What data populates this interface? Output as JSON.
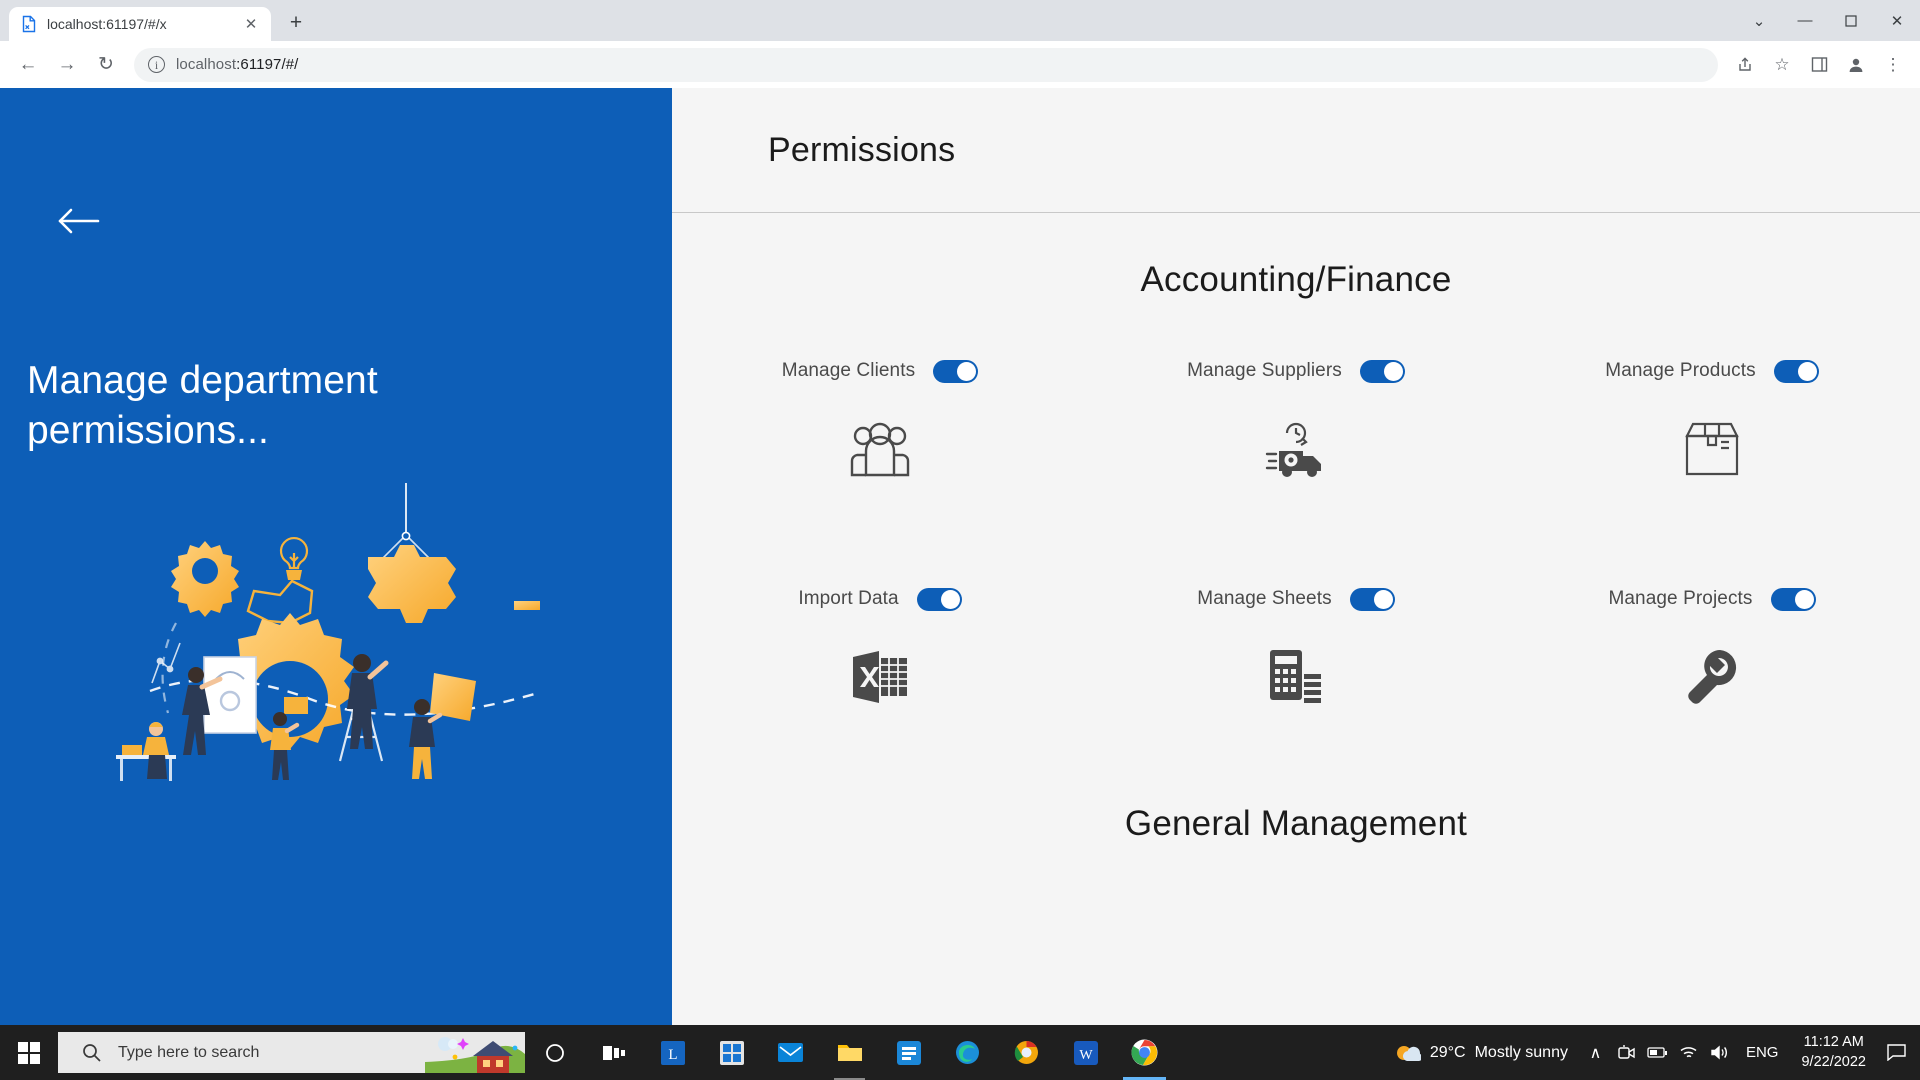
{
  "browser": {
    "tab": {
      "title": "localhost:61197/#/x",
      "favicon": "page-icon",
      "close_label": "✕"
    },
    "newtab_label": "+",
    "window_controls": {
      "minimize": "—",
      "maximize": "❐",
      "close": "✕",
      "chevron": "⌄"
    },
    "nav": {
      "back": "←",
      "forward": "→",
      "reload": "↻"
    },
    "omnibox": {
      "info_glyph": "i",
      "url_dim": "localhost",
      "url_rest": ":61197/#/",
      "full_url": "localhost:61197/#/"
    },
    "toolbar_icons": {
      "share": "share-icon",
      "bookmark": "☆",
      "sidepanel": "sidepanel-icon",
      "profile": "profile-icon",
      "menu": "⋮"
    }
  },
  "left_panel": {
    "back_button": "back-arrow",
    "heading": "Manage department permissions...",
    "illustration": "teamwork-gears-illustration",
    "bg_color": "#0d5eb7",
    "accent_color": "#f9b233"
  },
  "page": {
    "title": "Permissions",
    "sections": [
      {
        "title": "Accounting/Finance",
        "items": [
          {
            "label": "Manage Clients",
            "enabled": true,
            "icon": "people-group-icon"
          },
          {
            "label": "Manage Suppliers",
            "enabled": true,
            "icon": "delivery-truck-icon"
          },
          {
            "label": "Manage Products",
            "enabled": true,
            "icon": "package-box-icon"
          },
          {
            "label": "Import Data",
            "enabled": true,
            "icon": "excel-spreadsheet-icon"
          },
          {
            "label": "Manage Sheets",
            "enabled": true,
            "icon": "calculator-icon"
          },
          {
            "label": "Manage Projects",
            "enabled": true,
            "icon": "wrench-icon"
          }
        ]
      },
      {
        "title": "General Management",
        "items": []
      }
    ]
  },
  "taskbar": {
    "start": "windows-start-icon",
    "search_placeholder": "Type here to search",
    "apps": [
      {
        "name": "cortana-icon"
      },
      {
        "name": "task-view-icon"
      },
      {
        "name": "app-l-icon"
      },
      {
        "name": "microsoft-store-icon"
      },
      {
        "name": "mail-icon"
      },
      {
        "name": "file-explorer-icon"
      },
      {
        "name": "blue-app-icon"
      },
      {
        "name": "microsoft-edge-icon"
      },
      {
        "name": "chrome-canary-icon"
      },
      {
        "name": "word-icon"
      },
      {
        "name": "google-chrome-icon"
      }
    ],
    "weather": {
      "temperature": "29°C",
      "condition": "Mostly sunny"
    },
    "tray": {
      "chevron": "∧",
      "meet": "camera-icon",
      "battery": "battery-icon",
      "wifi": "wifi-icon",
      "volume": "volume-icon"
    },
    "language": "ENG",
    "time": "11:12 AM",
    "date": "9/22/2022",
    "action_center": "notification-icon"
  }
}
